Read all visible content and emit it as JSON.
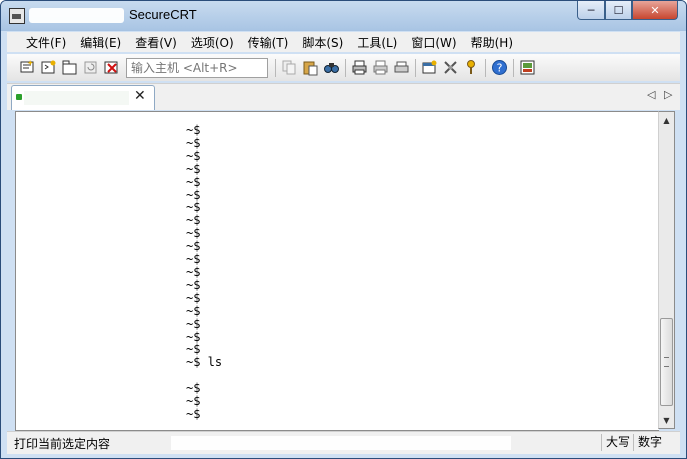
{
  "window": {
    "title": "SecureCRT",
    "controls": {
      "minimize": "─",
      "maximize": "☐",
      "close": "✕"
    }
  },
  "menu": [
    "文件(F)",
    "编辑(E)",
    "查看(V)",
    "选项(O)",
    "传输(T)",
    "脚本(S)",
    "工具(L)",
    "窗口(W)",
    "帮助(H)"
  ],
  "toolbar": {
    "connect_placeholder": "输入主机 <Alt+R>",
    "icons": [
      "quick-connect-icon",
      "connect-icon",
      "connect-tab-icon",
      "reconnect-icon",
      "disconnect-icon",
      "copy-icon",
      "paste-icon",
      "find-icon",
      "print-icon",
      "print-selection-icon",
      "print-setup-icon",
      "session-options-icon",
      "global-options-icon",
      "keymap-icon",
      "help-icon",
      "sftp-icon"
    ]
  },
  "tab": {
    "close_glyph": "✕"
  },
  "tab_nav": {
    "left": "◁",
    "right": "▷"
  },
  "terminal": {
    "lines": [
      "~$",
      "~$",
      "~$",
      "~$",
      "~$",
      "~$",
      "~$",
      "~$",
      "~$",
      "~$",
      "~$",
      "~$",
      "~$",
      "~$",
      "~$",
      "~$",
      "~$",
      "~$",
      "~$ ls",
      "",
      "~$",
      "~$",
      "~$"
    ]
  },
  "status": {
    "text": "打印当前选定内容",
    "caps": "大写",
    "num": "数字"
  }
}
